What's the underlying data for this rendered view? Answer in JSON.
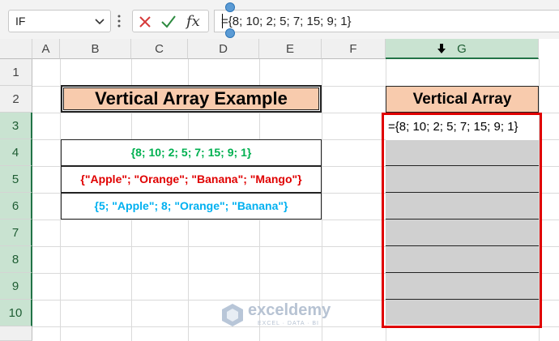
{
  "namebox": {
    "value": "IF"
  },
  "formula_bar": {
    "value": "={8; 10; 2; 5; 7; 15; 9; 1}",
    "cancel_icon": "x-icon",
    "enter_icon": "check-icon",
    "fx_label": "fx"
  },
  "columns": [
    "A",
    "B",
    "C",
    "D",
    "E",
    "F",
    "G"
  ],
  "selected_column": "G",
  "rows": [
    "1",
    "2",
    "3",
    "4",
    "5",
    "6",
    "7",
    "8",
    "9",
    "10"
  ],
  "title": "Vertical Array Example",
  "examples": [
    {
      "text": "{8; 10; 2; 5; 7; 15; 9; 1}",
      "color": "#00b050"
    },
    {
      "text": "{\"Apple\"; \"Orange\"; \"Banana\"; \"Mango\"}",
      "color": "#e00000"
    },
    {
      "text": "{5; \"Apple\"; 8; \"Orange\"; \"Banana\"}",
      "color": "#00b0f0"
    }
  ],
  "vertical_array": {
    "header": "Vertical Array",
    "cell_g3": "={8; 10; 2; 5; 7; 15; 9; 1}"
  },
  "watermark": {
    "name": "exceldemy",
    "tagline": "EXCEL · DATA · BI"
  },
  "colors": {
    "header_fill": "#f8cbad",
    "highlight": "#e00000",
    "selection": "#217346"
  }
}
